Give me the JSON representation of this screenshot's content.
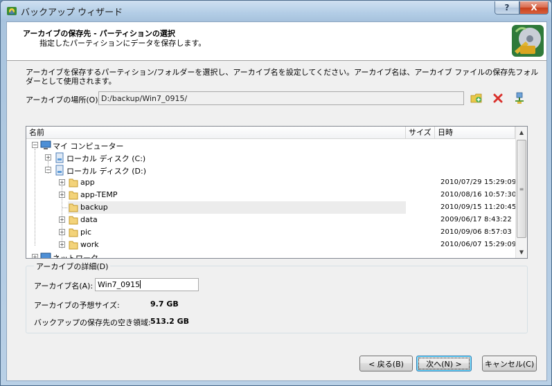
{
  "window": {
    "title": "バックアップ ウィザード"
  },
  "header": {
    "title": "アーカイブの保存先 - パーティションの選択",
    "subtitle": "指定したパーティションにデータを保存します。"
  },
  "description": "アーカイブを保存するパーティション/フォルダーを選択し、アーカイブ名を設定してください。アーカイブ名は、アーカイブ ファイルの保存先フォルダーとして使用されます。",
  "location": {
    "label": "アーカイブの場所(O):",
    "value": "D:/backup/Win7_0915/"
  },
  "tree": {
    "columns": {
      "name": "名前",
      "size": "サイズ",
      "date": "日時"
    },
    "nodes": [
      {
        "label": "マイ コンピューター",
        "date": ""
      },
      {
        "label": "ローカル ディスク (C:)",
        "date": ""
      },
      {
        "label": "ローカル ディスク (D:)",
        "date": ""
      },
      {
        "label": "app",
        "date": "2010/07/29 15:29:09"
      },
      {
        "label": "app-TEMP",
        "date": "2010/08/16 10:57:30"
      },
      {
        "label": "backup",
        "date": "2010/09/15 11:20:45"
      },
      {
        "label": "data",
        "date": "2009/06/17 8:43:22"
      },
      {
        "label": "pic",
        "date": "2010/09/06 8:57:03"
      },
      {
        "label": "work",
        "date": "2010/06/07 15:29:09"
      },
      {
        "label": "ネットワーク",
        "date": ""
      }
    ]
  },
  "details": {
    "legend": "アーカイブの詳細(D)",
    "name_label": "アーカイブ名(A):",
    "name_value": "Win7_0915",
    "size_label": "アーカイブの予想サイズ:",
    "size_value": "9.7 GB",
    "free_label": "バックアップの保存先の空き領域:",
    "free_value": "513.2 GB"
  },
  "buttons": {
    "back": "< 戻る(B)",
    "next": "次へ(N) >",
    "cancel": "キャンセル(C)",
    "help": "?",
    "close": "X"
  },
  "icons": [
    "app-icon",
    "wizard-header-icon",
    "new-folder-icon",
    "delete-icon",
    "network-location-icon",
    "folder-icon",
    "drive-icon",
    "computer-icon"
  ]
}
